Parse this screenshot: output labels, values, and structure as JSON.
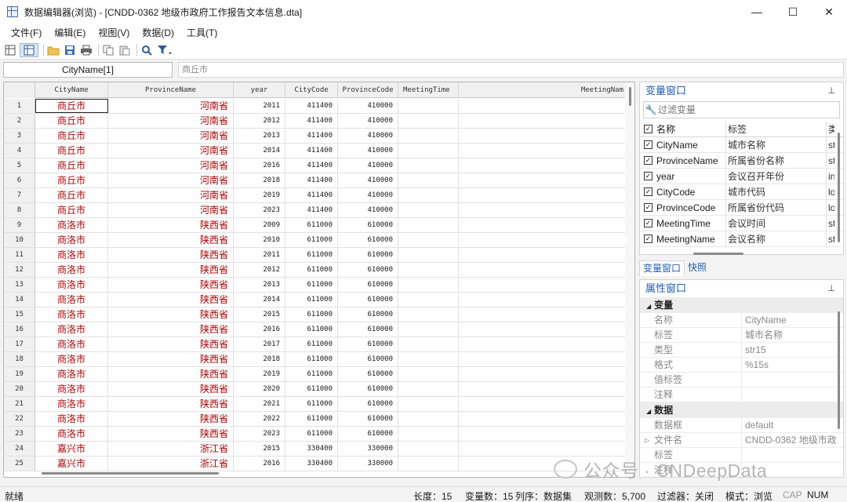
{
  "window": {
    "title": "数据编辑器(浏览) - [CNDD-0362 地级市政府工作报告文本信息.dta]",
    "minimize": "—",
    "maximize": "☐",
    "close": "✕"
  },
  "menu": [
    "文件(F)",
    "编辑(E)",
    "视图(V)",
    "数据(D)",
    "工具(T)"
  ],
  "toolbar_icons": [
    "data-editor-edit-icon",
    "data-editor-browse-icon",
    "open-folder-icon",
    "save-icon",
    "print-icon",
    "copy-icon",
    "paste-icon",
    "search-icon",
    "filter-icon"
  ],
  "address": {
    "cell_name": "CityName[1]",
    "cell_value": "商丘市"
  },
  "grid": {
    "columns": [
      "CityName",
      "ProvinceName",
      "year",
      "CityCode",
      "ProvinceCode",
      "MeetingTime",
      "MeetingNam"
    ],
    "rows": [
      [
        "1",
        "商丘市",
        "河南省",
        "2011",
        "411400",
        "410000"
      ],
      [
        "2",
        "商丘市",
        "河南省",
        "2012",
        "411400",
        "410000"
      ],
      [
        "3",
        "商丘市",
        "河南省",
        "2013",
        "411400",
        "410000"
      ],
      [
        "4",
        "商丘市",
        "河南省",
        "2014",
        "411400",
        "410000"
      ],
      [
        "5",
        "商丘市",
        "河南省",
        "2016",
        "411400",
        "410000"
      ],
      [
        "6",
        "商丘市",
        "河南省",
        "2018",
        "411400",
        "410000"
      ],
      [
        "7",
        "商丘市",
        "河南省",
        "2019",
        "411400",
        "410000"
      ],
      [
        "8",
        "商丘市",
        "河南省",
        "2023",
        "411400",
        "410000"
      ],
      [
        "9",
        "商洛市",
        "陕西省",
        "2009",
        "611000",
        "610000"
      ],
      [
        "10",
        "商洛市",
        "陕西省",
        "2010",
        "611000",
        "610000"
      ],
      [
        "11",
        "商洛市",
        "陕西省",
        "2011",
        "611000",
        "610000"
      ],
      [
        "12",
        "商洛市",
        "陕西省",
        "2012",
        "611000",
        "610000"
      ],
      [
        "13",
        "商洛市",
        "陕西省",
        "2013",
        "611000",
        "610000"
      ],
      [
        "14",
        "商洛市",
        "陕西省",
        "2014",
        "611000",
        "610000"
      ],
      [
        "15",
        "商洛市",
        "陕西省",
        "2015",
        "611000",
        "610000"
      ],
      [
        "16",
        "商洛市",
        "陕西省",
        "2016",
        "611000",
        "610000"
      ],
      [
        "17",
        "商洛市",
        "陕西省",
        "2017",
        "611000",
        "610000"
      ],
      [
        "18",
        "商洛市",
        "陕西省",
        "2018",
        "611000",
        "610000"
      ],
      [
        "19",
        "商洛市",
        "陕西省",
        "2019",
        "611000",
        "610000"
      ],
      [
        "20",
        "商洛市",
        "陕西省",
        "2020",
        "611000",
        "610000"
      ],
      [
        "21",
        "商洛市",
        "陕西省",
        "2021",
        "611000",
        "610000"
      ],
      [
        "22",
        "商洛市",
        "陕西省",
        "2022",
        "611000",
        "610000"
      ],
      [
        "23",
        "商洛市",
        "陕西省",
        "2023",
        "611000",
        "610000"
      ],
      [
        "24",
        "嘉兴市",
        "浙江省",
        "2015",
        "330400",
        "330000"
      ],
      [
        "25",
        "嘉兴市",
        "浙江省",
        "2016",
        "330400",
        "330000"
      ]
    ]
  },
  "var_panel": {
    "title": "变量窗口",
    "pin": "⊥",
    "filter_placeholder": "过滤变量",
    "headers": [
      "名称",
      "标签",
      "类"
    ],
    "variables": [
      [
        "CityName",
        "城市名称",
        "str"
      ],
      [
        "ProvinceName",
        "所属省份名称",
        "str"
      ],
      [
        "year",
        "会议召开年份",
        "int"
      ],
      [
        "CityCode",
        "城市代码",
        "lo"
      ],
      [
        "ProvinceCode",
        "所属省份代码",
        "lo"
      ],
      [
        "MeetingTime",
        "会议时间",
        "str"
      ],
      [
        "MeetingName",
        "会议名称",
        "str"
      ]
    ]
  },
  "tabs": [
    "变量窗口",
    "快照"
  ],
  "prop_panel": {
    "title": "属性窗口",
    "pin": "⊥",
    "group_variable": "变量",
    "variable_props": [
      [
        "名称",
        "CityName"
      ],
      [
        "标签",
        "城市名称"
      ],
      [
        "类型",
        "str15"
      ],
      [
        "格式",
        "%15s"
      ],
      [
        "值标签",
        ""
      ],
      [
        "注释",
        ""
      ]
    ],
    "group_data": "数据",
    "data_props": [
      [
        "数据框",
        "default"
      ],
      [
        "文件名",
        "CNDD-0362 地级市政"
      ],
      [
        "标签",
        ""
      ],
      [
        "注释",
        ""
      ]
    ]
  },
  "watermark": "公众号 · CNDeepData",
  "status": {
    "ready": "就绪",
    "length": "长度：15",
    "vars": "变量数：15",
    "order": "列序：数据集",
    "obs": "观测数：5,700",
    "filter": "过滤器：关闭",
    "mode": "模式：浏览",
    "cap": "CAP",
    "num": "NUM"
  }
}
